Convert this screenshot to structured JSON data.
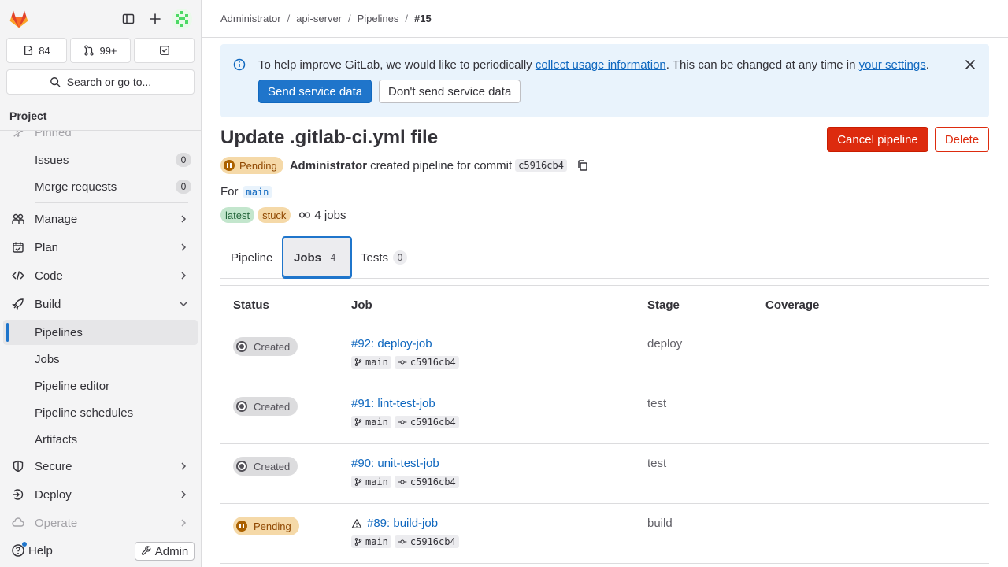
{
  "sidebar": {
    "counts": {
      "issues": "84",
      "merge_requests": "99+"
    },
    "search_label": "Search or go to...",
    "section_title": "Project",
    "pinned_label": "Pinned",
    "pinned_items": [
      {
        "label": "Issues",
        "count": "0"
      },
      {
        "label": "Merge requests",
        "count": "0"
      }
    ],
    "nav": {
      "manage": "Manage",
      "plan": "Plan",
      "code": "Code",
      "build": "Build",
      "secure": "Secure",
      "deploy": "Deploy",
      "operate": "Operate"
    },
    "build_items": [
      "Pipelines",
      "Jobs",
      "Pipeline editor",
      "Pipeline schedules",
      "Artifacts"
    ],
    "help": "Help",
    "admin": "Admin"
  },
  "breadcrumb": [
    "Administrator",
    "api-server",
    "Pipelines",
    "#15"
  ],
  "banner": {
    "text_before": "To help improve GitLab, we would like to periodically ",
    "link1": "collect usage information",
    "text_middle": ". This can be changed at any time in ",
    "link2": "your settings",
    "text_after": ".",
    "primary_btn": "Send service data",
    "secondary_btn": "Don't send service data"
  },
  "pipeline": {
    "title": "Update .gitlab-ci.yml file",
    "status": "Pending",
    "author": "Administrator",
    "action_text": "created pipeline for commit",
    "commit": "c5916cb4",
    "for_label": "For",
    "branch": "main",
    "tags": [
      "latest",
      "stuck"
    ],
    "jobs_count_text": "4 jobs",
    "cancel_btn": "Cancel pipeline",
    "delete_btn": "Delete"
  },
  "tabs": [
    {
      "label": "Pipeline",
      "count": null
    },
    {
      "label": "Jobs",
      "count": "4"
    },
    {
      "label": "Tests",
      "count": "0"
    }
  ],
  "table": {
    "headers": [
      "Status",
      "Job",
      "Stage",
      "Coverage"
    ],
    "rows": [
      {
        "status": "Created",
        "job": "#92: deploy-job",
        "ref": "main",
        "commit": "c5916cb4",
        "stage": "deploy",
        "warning": false
      },
      {
        "status": "Created",
        "job": "#91: lint-test-job",
        "ref": "main",
        "commit": "c5916cb4",
        "stage": "test",
        "warning": false
      },
      {
        "status": "Created",
        "job": "#90: unit-test-job",
        "ref": "main",
        "commit": "c5916cb4",
        "stage": "test",
        "warning": false
      },
      {
        "status": "Pending",
        "job": "#89: build-job",
        "ref": "main",
        "commit": "c5916cb4",
        "stage": "build",
        "warning": true
      }
    ]
  },
  "colors": {
    "primary": "#1f75cb",
    "danger": "#dd2b0e",
    "pending_bg": "#f5d9a8",
    "link": "#1068bf"
  }
}
